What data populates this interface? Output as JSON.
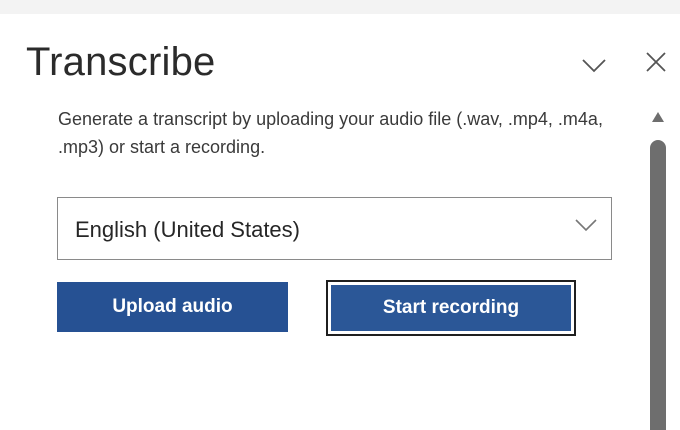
{
  "pane": {
    "title": "Transcribe",
    "description": "Generate a transcript by uploading your audio file (.wav, .mp4, .m4a, .mp3) or start a recording.",
    "language": {
      "selected": "English (United States)"
    },
    "buttons": {
      "upload_label": "Upload audio",
      "record_label": "Start recording"
    },
    "icons": {
      "collapse": "chevron-down-icon",
      "close": "close-icon",
      "scroll_up": "scroll-up-arrow-icon"
    }
  },
  "colors": {
    "primary_button": "#2b5797",
    "title_text": "#2b2b2b",
    "scrollbar_thumb": "#6e6e6e"
  }
}
